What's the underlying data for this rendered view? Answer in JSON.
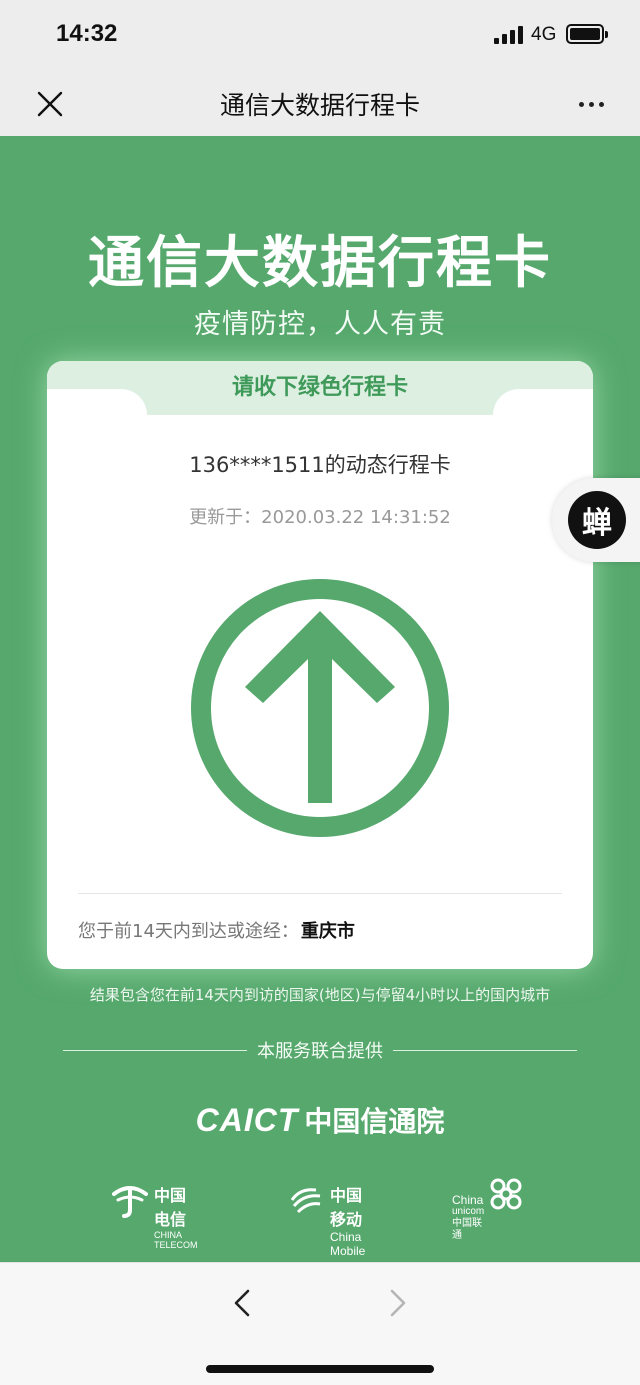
{
  "status_bar": {
    "time": "14:32",
    "network": "4G",
    "signal_bars": 4,
    "battery_level": 1.0
  },
  "nav": {
    "title": "通信大数据行程卡",
    "close_icon": "close-icon",
    "more_icon": "more-dots-icon"
  },
  "header": {
    "title": "通信大数据行程卡",
    "slogan": "疫情防控，人人有责"
  },
  "card": {
    "tab_label": "请收下绿色行程卡",
    "phone_line": "136****1511的动态行程卡",
    "updated_line": "更新于：2020.03.22 14:31:52",
    "status_icon": "green-up-arrow-icon",
    "status_color": "#56a86d",
    "route_label": "您于前14天内到达或途经：",
    "route_city": "重庆市"
  },
  "footnote": "结果包含您在前14天内到访的国家(地区)与停留4小时以上的国内城市",
  "providers": {
    "heading": "本服务联合提供",
    "caict_en": "CAICT",
    "caict_cn": "中国信通院",
    "telecom_cn": "中国电信",
    "telecom_en": "CHINA TELECOM",
    "mobile_cn": "中国移动",
    "mobile_en": "China Mobile",
    "unicom_en_top": "China",
    "unicom_en_bottom": "unicom中国联通"
  },
  "floating_badge": {
    "label": "蝉"
  },
  "bottom_nav": {
    "back_icon": "chevron-left-icon",
    "forward_icon": "chevron-right-icon"
  },
  "colors": {
    "page_green": "#56a86d",
    "tab_bg": "#dcefe1",
    "tab_text": "#3f9a5a"
  }
}
